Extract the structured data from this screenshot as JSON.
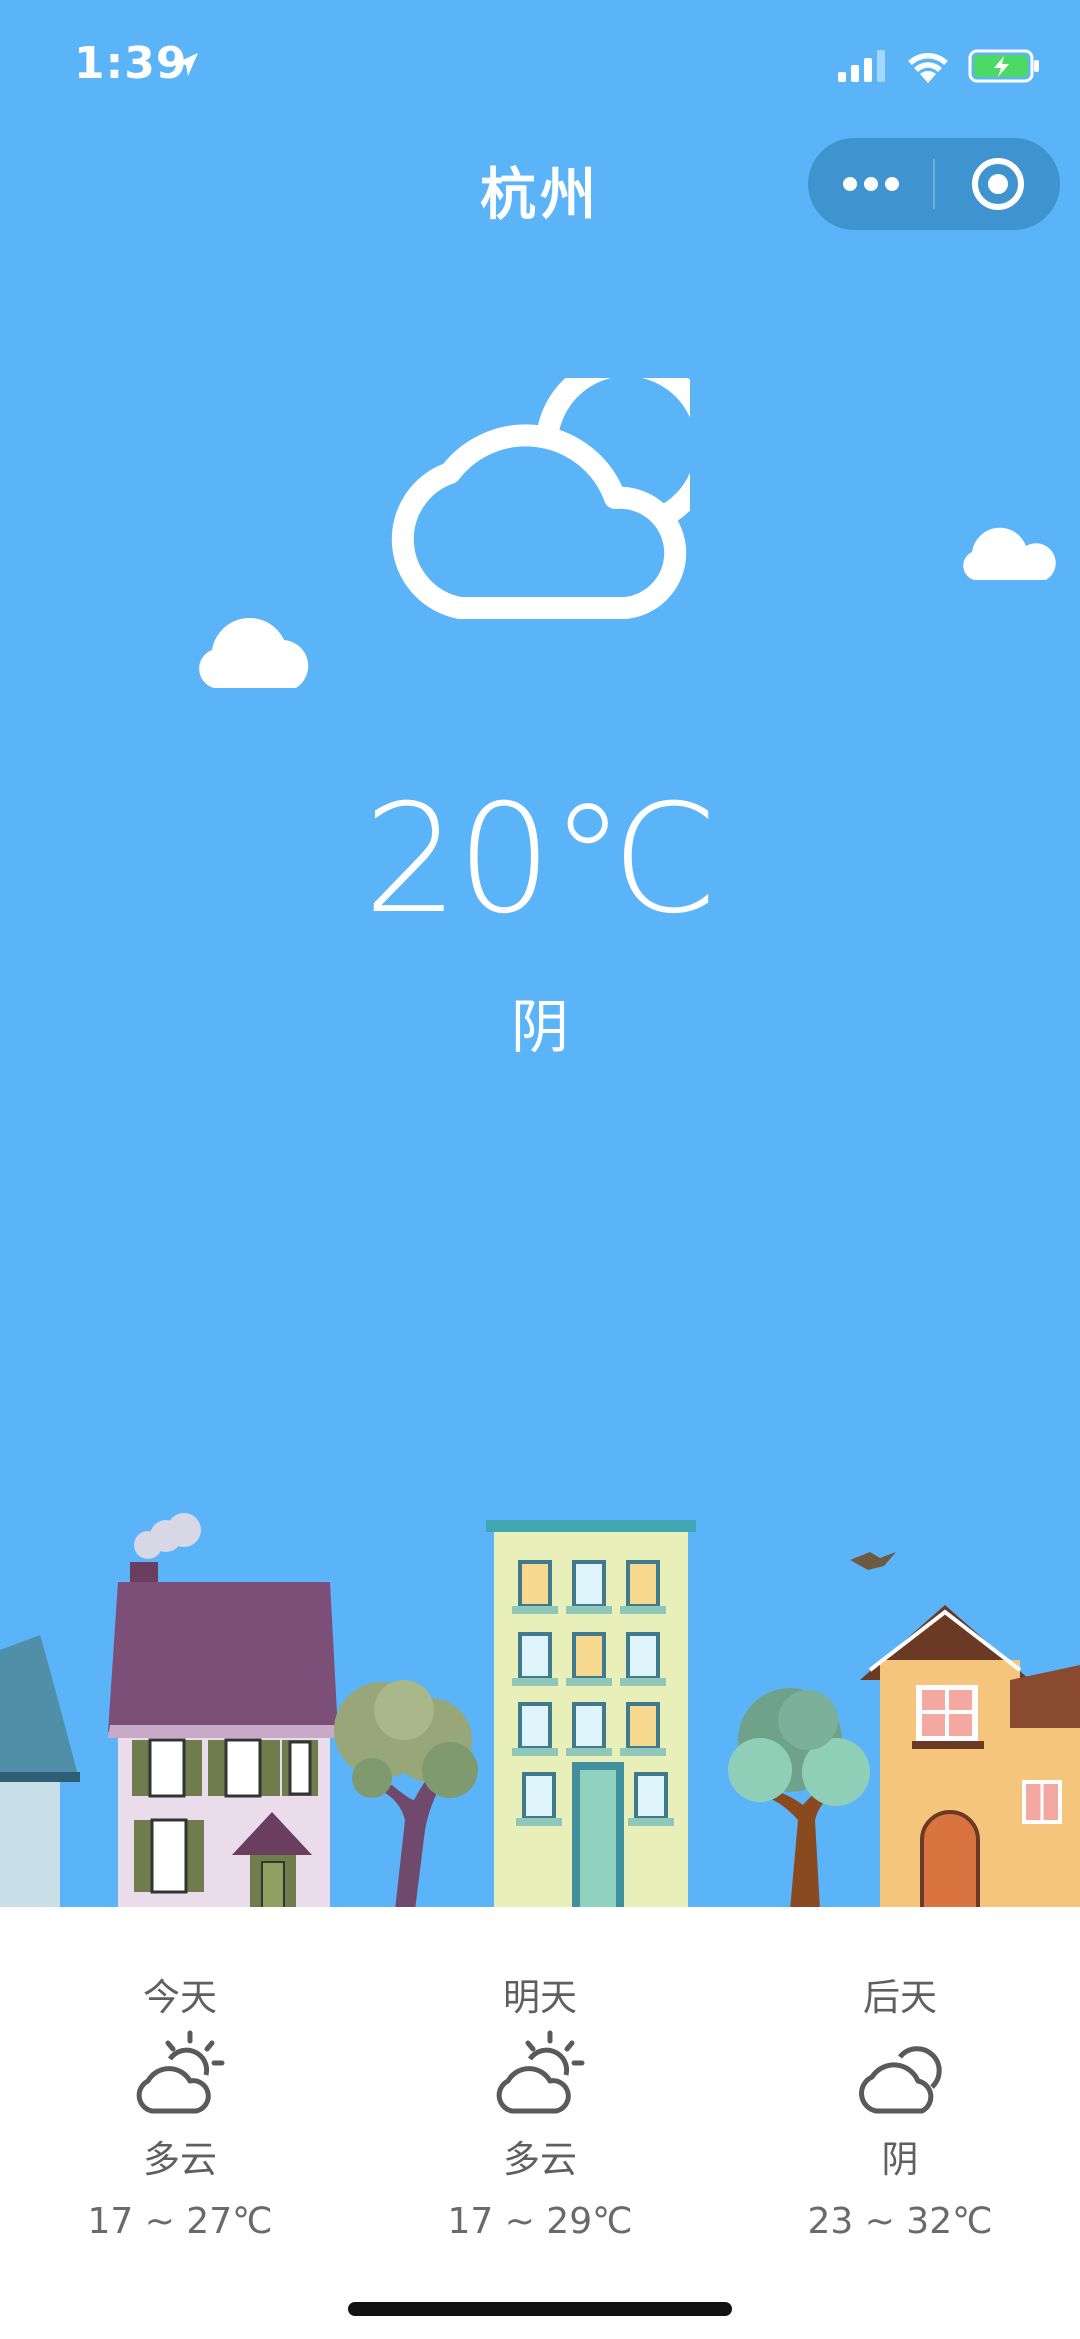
{
  "status_bar": {
    "time": "1:39",
    "icons": [
      "location-arrow-icon",
      "signal-icon",
      "wifi-icon",
      "battery-charging-icon"
    ]
  },
  "nav": {
    "title": "杭州",
    "capsule": [
      "more-icon",
      "close-target-icon"
    ]
  },
  "current": {
    "icon": "cloudy-icon",
    "temperature": "20℃",
    "condition": "阴"
  },
  "forecast": [
    {
      "label": "今天",
      "icon": "partly-cloudy-icon",
      "desc": "多云",
      "range": "17 ~ 27℃"
    },
    {
      "label": "明天",
      "icon": "partly-cloudy-icon",
      "desc": "多云",
      "range": "17 ~ 29℃"
    },
    {
      "label": "后天",
      "icon": "cloudy-icon",
      "desc": "阴",
      "range": "23 ~ 32℃"
    }
  ],
  "colors": {
    "sky": "#5bb4f8",
    "capsule": "#3f93cf",
    "panel": "#ffffff",
    "panel_text": "#5f5f5f"
  }
}
